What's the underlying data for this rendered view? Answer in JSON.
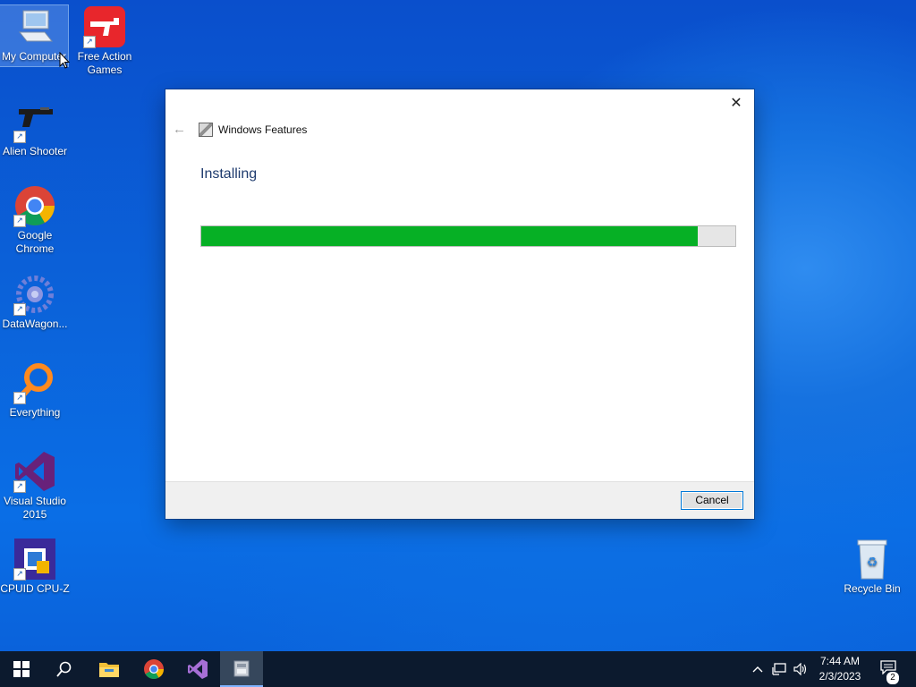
{
  "desktop": {
    "icons": [
      {
        "label": "My Computer",
        "icon": "computer-icon"
      },
      {
        "label": "Free Action Games",
        "icon": "gun-icon"
      },
      {
        "label": "Alien Shooter",
        "icon": "pistol-icon"
      },
      {
        "label": "Google Chrome",
        "icon": "chrome-icon"
      },
      {
        "label": "DataWagon...",
        "icon": "datawagon-icon"
      },
      {
        "label": "Everything",
        "icon": "magnifier-icon"
      },
      {
        "label": "Visual Studio 2015",
        "icon": "visual-studio-icon"
      },
      {
        "label": "CPUID CPU-Z",
        "icon": "cpu-icon"
      },
      {
        "label": "Recycle Bin",
        "icon": "recycle-bin-icon"
      }
    ]
  },
  "dialog": {
    "title": "Windows Features",
    "heading": "Installing",
    "progress_percent": 93,
    "cancel_label": "Cancel",
    "close_symbol": "✕",
    "back_symbol": "←"
  },
  "taskbar": {
    "clock_time": "7:44 AM",
    "clock_date": "2/3/2023",
    "notification_count": "2",
    "accent": "#06b025"
  }
}
